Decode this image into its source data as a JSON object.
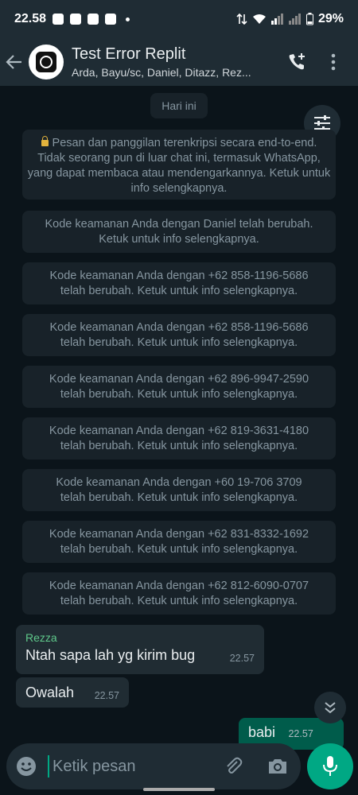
{
  "status_bar": {
    "time": "22.58",
    "battery": "29%"
  },
  "header": {
    "title": "Test Error Replit",
    "subtitle": "Arda, Bayu/sc, Daniel, Ditazz, Rez..."
  },
  "chat": {
    "date_pill": "Hari ini",
    "encryption_notice": "Pesan dan panggilan terenkripsi secara end-to-end. Tidak seorang pun di luar chat ini, termasuk WhatsApp, yang dapat membaca atau mendengarkannya. Ketuk untuk info selengkapnya.",
    "security_notices": [
      {
        "line1": "Kode keamanan Anda dengan Daniel telah berubah.",
        "line2": "Ketuk untuk info selengkapnya."
      },
      {
        "line1": "Kode keamanan Anda dengan +62 858-1196-5686",
        "line2": "telah berubah. Ketuk untuk info selengkapnya."
      },
      {
        "line1": "Kode keamanan Anda dengan +62 858-1196-5686",
        "line2": "telah berubah. Ketuk untuk info selengkapnya."
      },
      {
        "line1": "Kode keamanan Anda dengan +62 896-9947-2590",
        "line2": "telah berubah. Ketuk untuk info selengkapnya."
      },
      {
        "line1": "Kode keamanan Anda dengan +62 819-3631-4180",
        "line2": "telah berubah. Ketuk untuk info selengkapnya."
      },
      {
        "line1": "Kode keamanan Anda dengan +60 19-706 3709",
        "line2": "telah berubah. Ketuk untuk info selengkapnya."
      },
      {
        "line1": "Kode keamanan Anda dengan +62 831-8332-1692",
        "line2": "telah berubah. Ketuk untuk info selengkapnya."
      },
      {
        "line1": "Kode keamanan Anda dengan +62 812-6090-0707",
        "line2": "telah berubah. Ketuk untuk info selengkapnya."
      }
    ],
    "messages": [
      {
        "sender": "Rezza",
        "text": "Ntah sapa lah yg kirim bug",
        "time": "22.57",
        "direction": "in"
      },
      {
        "text": "Owalah",
        "time": "22.57",
        "direction": "in"
      },
      {
        "text": "babi",
        "time": "22.57",
        "direction": "out"
      }
    ]
  },
  "composer": {
    "placeholder": "Ketik pesan"
  },
  "colors": {
    "accent": "#00a884",
    "sender_name": "#5fc98b",
    "outgoing_bubble": "#005c4b",
    "background": "#0b141a"
  },
  "icons": [
    "back-arrow-icon",
    "group-avatar-icon",
    "add-call-icon",
    "more-vert-icon",
    "lock-icon",
    "tune-icon",
    "double-chevron-down-icon",
    "emoji-icon",
    "attach-icon",
    "camera-icon",
    "mic-icon"
  ]
}
